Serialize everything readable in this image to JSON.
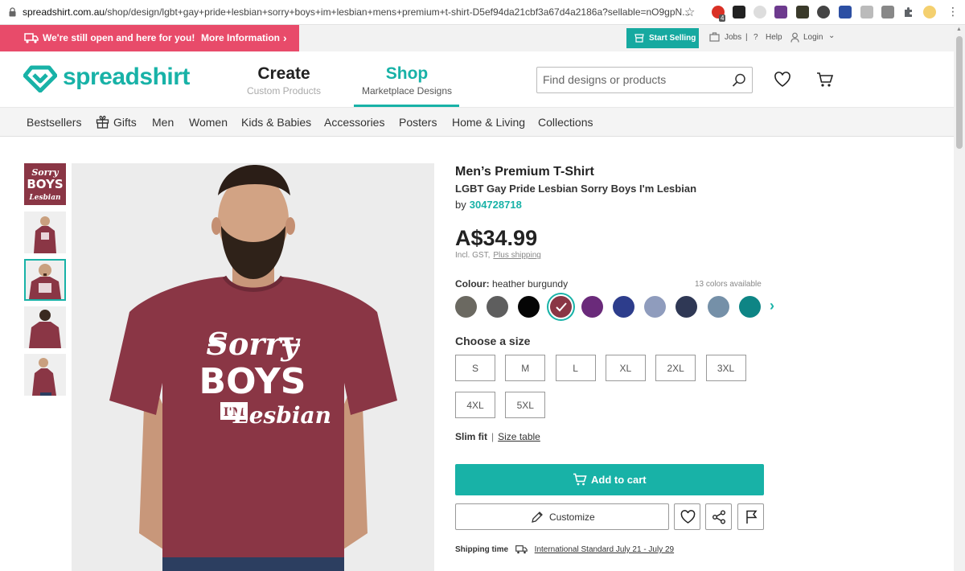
{
  "browser": {
    "url_domain": "spreadshirt.com.au",
    "url_path": "/shop/design/lgbt+gay+pride+lesbian+sorry+boys+im+lesbian+mens+premium+t-shirt-D5ef94da21cbf3a67d4a2186a?sellable=nO9gpN...",
    "extension_badge": "4"
  },
  "promo": {
    "text": "We're still open and here for you!",
    "more": "More Information"
  },
  "utility": {
    "start_selling": "Start Selling",
    "jobs": "Jobs",
    "help": "Help",
    "login": "Login"
  },
  "header": {
    "logo": "spreadshirt",
    "tabs": [
      {
        "label": "Create",
        "sub": "Custom Products"
      },
      {
        "label": "Shop",
        "sub": "Marketplace Designs"
      }
    ],
    "search_placeholder": "Find designs or products"
  },
  "categories": [
    "Bestsellers",
    "Gifts",
    "Men",
    "Women",
    "Kids & Babies",
    "Accessories",
    "Posters",
    "Home & Living",
    "Collections"
  ],
  "product": {
    "title": "Men’s Premium T-Shirt",
    "design": "LGBT Gay Pride Lesbian Sorry Boys I'm Lesbian",
    "by_label": "by",
    "author": "304728718",
    "price": "A$34.99",
    "tax": "Incl. GST,",
    "shipping": "Plus shipping",
    "print": {
      "line1": "Sorry",
      "line2": "BOYS",
      "line3a": "I'M",
      "line3b": "Lesbian"
    }
  },
  "colors": {
    "label": "Colour:",
    "selected": "heather burgundy",
    "count": "13 colors available",
    "swatches": [
      "#6b6961",
      "#5e5e5e",
      "#050505",
      "#8a3645",
      "#6a2a7a",
      "#2d3d8c",
      "#8f9cbd",
      "#2f3855",
      "#7590a8",
      "#0e8585"
    ],
    "selected_color": "#8a3645"
  },
  "sizes": {
    "label": "Choose a size",
    "options": [
      "S",
      "M",
      "L",
      "XL",
      "2XL",
      "3XL",
      "4XL",
      "5XL"
    ]
  },
  "fit": {
    "label": "Slim fit",
    "table": "Size table"
  },
  "actions": {
    "add_to_cart": "Add to cart",
    "customize": "Customize"
  },
  "shipping": {
    "label": "Shipping time",
    "value": "International Standard July 21 - July 29"
  },
  "accent_color": "#18b2a7",
  "promo_color": "#e84b6a"
}
